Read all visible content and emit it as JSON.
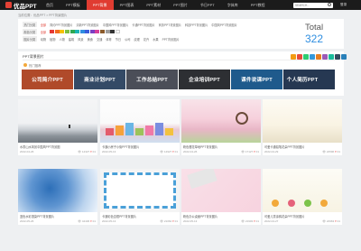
{
  "brand": {
    "logo_text": "优品PPT"
  },
  "nav": [
    "首页",
    "PPT模板",
    "PPT背景",
    "PPT图表",
    "PPT素材",
    "PPT图片",
    "节日PPT",
    "字体库",
    "PPT教程"
  ],
  "nav_active": 2,
  "search": {
    "placeholder": "SEARCH..."
  },
  "login": "登录",
  "breadcrumb": "当前位置：优品PPT > PPT背景图片",
  "filter": {
    "rows": [
      {
        "label": "热门分类",
        "options": [
          "全部",
          "简约PPT背景图片",
          "清新PPT背景图片",
          "中国风PPT背景图片",
          "卡通PPT背景图片",
          "商务PPT背景图片",
          "科技PPT背景图片",
          "中国风PPT背景图片"
        ],
        "selected": 0
      },
      {
        "label": "颜色分类",
        "options": [
          "全部"
        ],
        "selected": 0
      },
      {
        "label": "图片分类",
        "options": [
          "动物",
          "植物",
          "人物",
          "建筑",
          "风景",
          "美食",
          "交通",
          "体育",
          "节日",
          "公司",
          "纹理",
          "花卉",
          "水果",
          "PPT背景图片"
        ],
        "selected": -1
      }
    ],
    "colors": [
      "#e53935",
      "#f36c21",
      "#f6c000",
      "#7cc043",
      "#2fa84f",
      "#1ab4b4",
      "#2f8ee0",
      "#3b5bdb",
      "#7a3fc4",
      "#d63f9a",
      "#8b5a2b",
      "#9e9e9e",
      "#333333",
      "#ffffff"
    ],
    "total_label": "Total",
    "total_value": "322"
  },
  "section": {
    "title": "PPT背景图片",
    "hot_label": "热门推荐",
    "share_colors": [
      "#f39c12",
      "#e74c3c",
      "#2ecc71",
      "#3498db",
      "#e67e22",
      "#9b59b6",
      "#1abc9c",
      "#34495e",
      "#2980b9"
    ]
  },
  "categories": [
    {
      "label": "公司简介PPT",
      "bg": "#b04a2a"
    },
    {
      "label": "商业计划PPT",
      "bg": "#344a66"
    },
    {
      "label": "工作总结PPT",
      "bg": "#4b4e58"
    },
    {
      "label": "企业培训PPT",
      "bg": "#2d2f33"
    },
    {
      "label": "课件说课PPT",
      "bg": "#1f5a8c"
    },
    {
      "label": "个人简历PPT",
      "bg": "#263852",
      "more": "小编推荐"
    }
  ],
  "cards": [
    {
      "title": "水墨山水风景中国风PPT背景图",
      "date": "2022-04-26",
      "views": "14327",
      "likes": "01"
    },
    {
      "title": "卡通小房子小街PPT背景图片",
      "date": "2022-05-13",
      "views": "14927",
      "likes": "01"
    },
    {
      "title": "粉色樱花草地PPT背景图片",
      "date": "2022-04-26",
      "views": "17127",
      "likes": "01"
    },
    {
      "title": "可爱卡通铅笔花朵PPT背景图片",
      "date": "2022-04-29",
      "views": "22596",
      "likes": "01"
    },
    {
      "title": "蓝色水彩渲染PPT背景图片",
      "date": "2022-05-26",
      "views": "44436",
      "likes": "01"
    },
    {
      "title": "卡通彩色边框PPT背景图片",
      "date": "2022-05-13",
      "views": "21062",
      "likes": "01"
    },
    {
      "title": "粉色办公桌面PPT背景图片",
      "date": "2022-05-13",
      "views": "21903",
      "likes": "01"
    },
    {
      "title": "可爱儿童涂鸦花朵PPT背景图片",
      "date": "2022-04-27",
      "views": "22963",
      "likes": "01"
    }
  ]
}
